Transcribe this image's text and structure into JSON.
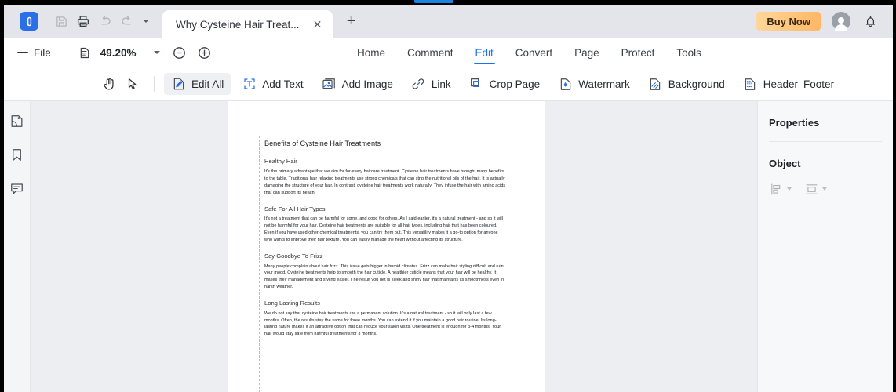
{
  "window": {
    "accent_blue": "#1a82e2",
    "brand_blue": "#2a6fe5"
  },
  "tabbar": {
    "logo_name": "pdf-app-logo",
    "quick_actions": [
      {
        "name": "save-icon",
        "label": "Save",
        "disabled": true
      },
      {
        "name": "print-icon",
        "label": "Print",
        "disabled": false
      },
      {
        "name": "undo-icon",
        "label": "Undo",
        "disabled": true
      },
      {
        "name": "redo-icon",
        "label": "Redo",
        "disabled": true
      }
    ],
    "quick_actions_more_label": "More",
    "document_tab": {
      "title": "Why Cysteine Hair Treat...",
      "close_glyph": "✕"
    },
    "new_tab_glyph": "+",
    "buy_now_label": "Buy Now",
    "account_label": "Account",
    "notifications_label": "Notifications"
  },
  "menurow": {
    "file_label": "File",
    "zoom": {
      "page_fit_label": "Page Fit",
      "value": "49.20%",
      "zoom_out_label": "Zoom Out",
      "zoom_in_label": "Zoom In"
    },
    "tabs": [
      {
        "label": "Home",
        "active": false
      },
      {
        "label": "Comment",
        "active": false
      },
      {
        "label": "Edit",
        "active": true
      },
      {
        "label": "Convert",
        "active": false
      },
      {
        "label": "Page",
        "active": false
      },
      {
        "label": "Protect",
        "active": false
      },
      {
        "label": "Tools",
        "active": false
      }
    ]
  },
  "ribbon": {
    "hand_tool_label": "Hand Tool",
    "select_tool_label": "Select Tool",
    "items": [
      {
        "label": "Edit All",
        "icon": "edit-all-icon",
        "selected": true
      },
      {
        "label": "Add Text",
        "icon": "add-text-icon",
        "selected": false
      },
      {
        "label": "Add Image",
        "icon": "add-image-icon",
        "selected": false
      },
      {
        "label": "Link",
        "icon": "link-icon",
        "selected": false
      },
      {
        "label": "Crop Page",
        "icon": "crop-page-icon",
        "selected": false
      },
      {
        "label": "Watermark",
        "icon": "watermark-icon",
        "selected": false
      },
      {
        "label": "Background",
        "icon": "background-icon",
        "selected": false
      },
      {
        "label": "Header",
        "icon": "header-footer-icon",
        "selected": false
      },
      {
        "label": "Footer",
        "icon": "",
        "selected": false
      }
    ]
  },
  "left_rail": {
    "items": [
      {
        "name": "thumbnails-icon",
        "label": "Page Thumbnails"
      },
      {
        "name": "bookmark-icon",
        "label": "Bookmarks"
      },
      {
        "name": "comment-icon",
        "label": "Comments"
      }
    ]
  },
  "properties_panel": {
    "title": "Properties",
    "object_section_label": "Object",
    "tools": [
      {
        "name": "align-objects-icon",
        "label": "Align"
      },
      {
        "name": "distribute-objects-icon",
        "label": "Distribute"
      }
    ]
  },
  "document": {
    "title": "Benefits of Cysteine Hair Treatments",
    "sections": [
      {
        "heading": "Healthy Hair",
        "body": "It's the primary advantage that we aim for for every haircare treatment. Cysteine hair treatments have brought many benefits to the table. Traditional hair relaxing treatments use strong chemicals that can strip the nutritional oils of the hair. It is actually damaging the structure of your hair. In contrast, cysteine hair treatments work naturally. They infuse the hair with amino acids that can support its health."
      },
      {
        "heading": "Safe For All Hair Types",
        "body": "It's not a treatment that can be harmful for some, and good for others. As I said earlier, it's a natural treatment - and so it will not be harmful for your hair. Cysteine hair treatments are suitable for all hair types, including hair that has been coloured. Even if you have used other chemical treatments, you can try them out. This versatility makes it a go-to option for anyone who wants to improve their hair texture. You can easily manage the heart without affecting its structure."
      },
      {
        "heading": "Say Goodbye To Frizz",
        "body": "Many people complain about hair frizz. This issue gets bigger in humid climates. Frizz can make hair styling difficult and ruin your mood. Cysteine treatments help to smooth the hair cuticle. A healthier cuticle means that your hair will be healthy. It makes their management and styling easier. The result you get is sleek and shiny hair that maintains its smoothness even in harsh weather."
      },
      {
        "heading": "Long Lasting Results",
        "body": "We do not say that cysteine hair treatments are a permanent solution. It's a natural treatment - so it will only last a few months. Often, the results stay the same for three months. You can extend it if you maintain a good hair routine. Its long-lasting nature makes it an attractive option that can reduce your salon visits. One treatment is enough for 3-4 months! Your hair would stay safe from harmful treatments for 3 months."
      }
    ]
  }
}
